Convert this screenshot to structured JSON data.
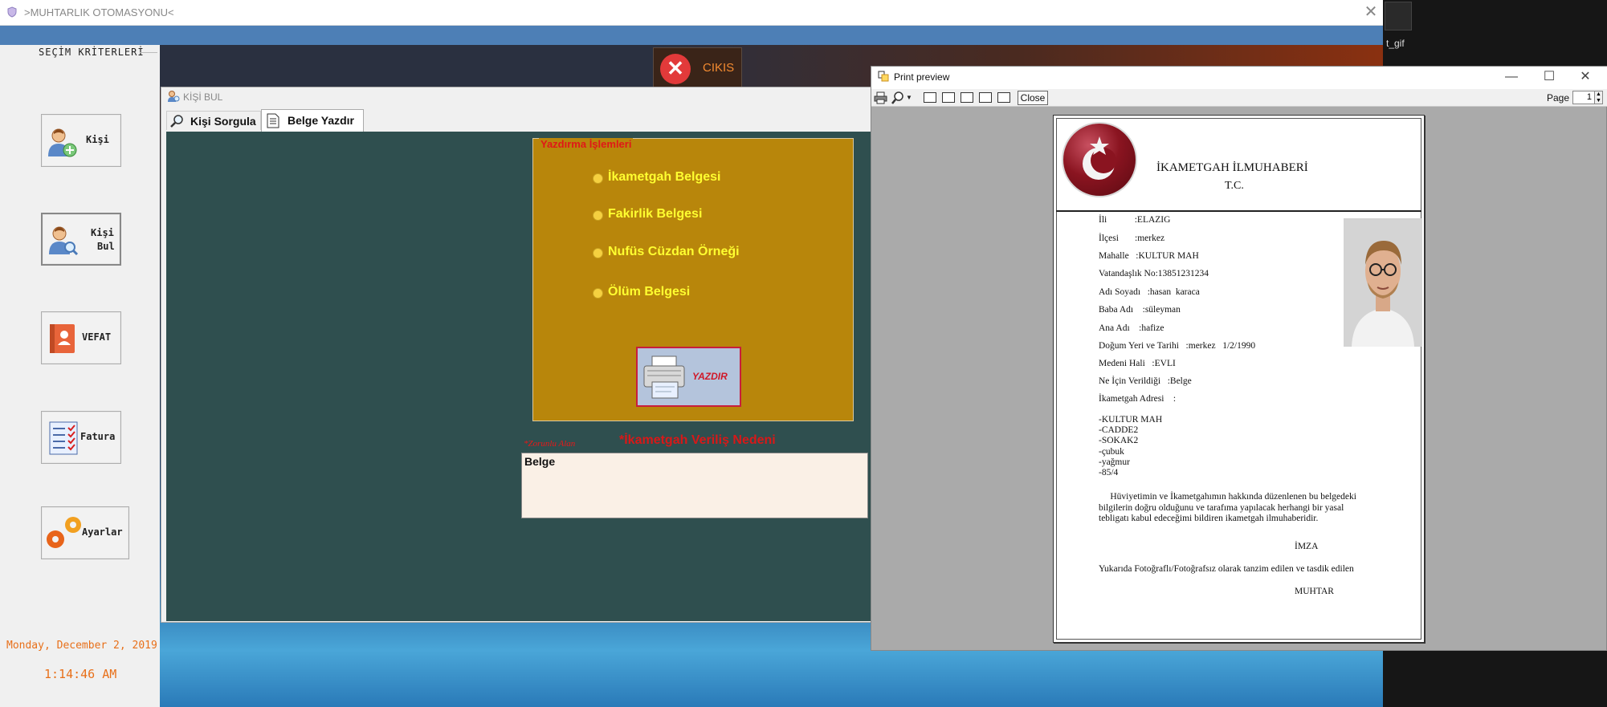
{
  "main_window": {
    "title": ">MUHTARLIK OTOMASYONU<",
    "close_glyph": "✕"
  },
  "sidebar": {
    "title": "SEÇİM KRİTERLERİ",
    "buttons": [
      {
        "label": "Kişi",
        "icon": "add-person-icon"
      },
      {
        "label_line1": "Kişi",
        "label_line2": "Bul",
        "icon": "find-person-icon"
      },
      {
        "label": "VEFAT",
        "icon": "contact-book-icon"
      },
      {
        "label": "Fatura",
        "icon": "checklist-icon"
      },
      {
        "label": "Ayarlar",
        "icon": "gears-icon"
      }
    ],
    "date": "Monday, December 2, 2019",
    "time": "1:14:46 AM"
  },
  "exit_button": {
    "label": "CIKIS",
    "glyph": "✕"
  },
  "desktop_label": "t_gif",
  "child_window": {
    "title": "KİŞİ BUL",
    "tabs": [
      {
        "label": "Kişi Sorgula",
        "icon": "magnifier-icon"
      },
      {
        "label": "Belge Yazdır",
        "icon": "document-icon"
      }
    ],
    "print_group": {
      "title": "Yazdırma İşlemleri",
      "options": [
        "İkametgah Belgesi",
        "Fakirlik Belgesi",
        "Nufüs Cüzdan Örneği",
        "Ölüm Belgesi"
      ],
      "print_button_label": "YAZDIR"
    },
    "required_note": "*Zorunlu Alan",
    "reason_label": "*İkametgah Veriliş Nedeni",
    "reason_value": "Belge"
  },
  "print_preview": {
    "title": "Print preview",
    "close_button": "Close",
    "page_label": "Page",
    "page_value": "1",
    "window_controls": [
      "—",
      "☐",
      "✕"
    ],
    "document": {
      "title": "İKAMETGAH İLMUHABERİ",
      "subtitle": "T.C.",
      "fields": [
        "İli            :ELAZIG",
        "İlçesi       :merkez",
        "Mahalle   :KULTUR MAH",
        "Vatandaşlık No:13851231234",
        "Adı Soyadı   :hasan  karaca",
        "Baba Adı    :süleyman",
        "Ana Adı    :hafize",
        "Doğum Yeri ve Tarihi   :merkez   1/2/1990",
        "Medeni Hali   :EVLI",
        "Ne İçin Verildiği   :Belge",
        "İkametgah Adresi    :"
      ],
      "address": [
        "-KULTUR MAH",
        "-CADDE2",
        "-SOKAK2",
        "-çubuk",
        "-yağmur",
        "-85/4"
      ],
      "statement": [
        "     Hüviyetimin ve İkametgahımın hakkında düzenlenen bu belgedeki",
        "bilgilerin doğru olduğunu ve tarafıma yapılacak herhangi bir yasal",
        "tebligatı kabul edeceğimi bildiren ikametgah ilmuhaberidir."
      ],
      "signature": "İMZA",
      "footer_note": "Yukarıda Fotoğraflı/Fotoğrafsız olarak tanzim edilen ve tasdik edilen",
      "muhtar": "MUHTAR"
    }
  }
}
